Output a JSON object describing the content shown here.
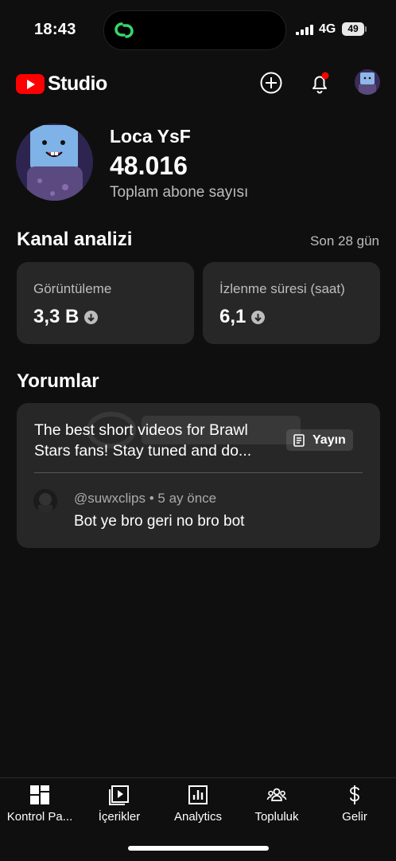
{
  "status_bar": {
    "time": "18:43",
    "network": "4G",
    "battery": "49"
  },
  "header": {
    "app_name": "Studio"
  },
  "channel": {
    "name": "Loca YsF",
    "subscriber_count": "48.016",
    "subscriber_label": "Toplam abone sayısı"
  },
  "analytics": {
    "title": "Kanal analizi",
    "range": "Son 28 gün",
    "metrics": [
      {
        "label": "Görüntüleme",
        "value": "3,3 B",
        "trend": "down"
      },
      {
        "label": "İzlenme süresi (saat)",
        "value": "6,1",
        "trend": "down"
      }
    ]
  },
  "comments": {
    "title": "Yorumlar",
    "video_title_line1": "The best short videos for Brawl",
    "video_title_line2": "Stars fans! Stay tuned and do...",
    "badge": "Yayın",
    "author": "@suwxclips",
    "time": "5 ay önce",
    "text": "Bot ye bro geri no bro bot"
  },
  "bottom_nav": [
    {
      "label": "Kontrol Pa...",
      "icon": "dashboard-icon"
    },
    {
      "label": "İçerikler",
      "icon": "content-icon"
    },
    {
      "label": "Analytics",
      "icon": "analytics-icon"
    },
    {
      "label": "Topluluk",
      "icon": "community-icon"
    },
    {
      "label": "Gelir",
      "icon": "earn-icon"
    }
  ],
  "colors": {
    "background": "#0f0f0f",
    "card": "#272727",
    "brand_red": "#ff0000",
    "notification_dot": "#ff0000"
  }
}
